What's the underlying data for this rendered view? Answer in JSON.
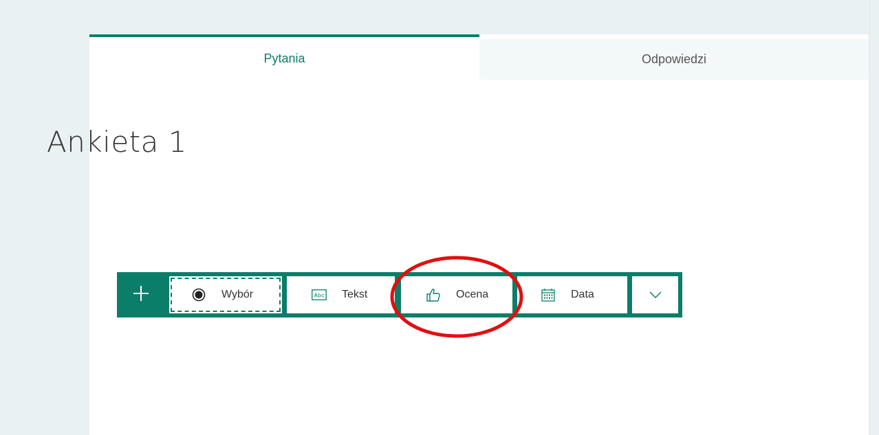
{
  "tabs": {
    "questions": "Pytania",
    "responses": "Odpowiedzi"
  },
  "form": {
    "title": "Ankieta 1"
  },
  "toolbar": {
    "add_icon": "plus-icon",
    "buttons": [
      {
        "label": "Wybór",
        "icon": "radio-icon"
      },
      {
        "label": "Tekst",
        "icon": "abc-text-icon"
      },
      {
        "label": "Ocena",
        "icon": "thumbs-up-icon"
      },
      {
        "label": "Data",
        "icon": "calendar-icon"
      }
    ],
    "more_icon": "chevron-down-icon"
  },
  "colors": {
    "accent": "#0b7e6a",
    "annotation": "#e01010",
    "background": "#e9f1f3"
  }
}
